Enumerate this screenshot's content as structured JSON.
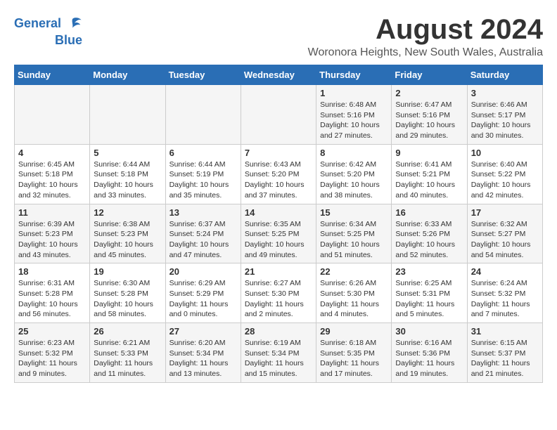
{
  "logo": {
    "line1": "General",
    "line2": "Blue"
  },
  "title": "August 2024",
  "location": "Woronora Heights, New South Wales, Australia",
  "weekdays": [
    "Sunday",
    "Monday",
    "Tuesday",
    "Wednesday",
    "Thursday",
    "Friday",
    "Saturday"
  ],
  "weeks": [
    [
      {
        "day": "",
        "info": ""
      },
      {
        "day": "",
        "info": ""
      },
      {
        "day": "",
        "info": ""
      },
      {
        "day": "",
        "info": ""
      },
      {
        "day": "1",
        "info": "Sunrise: 6:48 AM\nSunset: 5:16 PM\nDaylight: 10 hours\nand 27 minutes."
      },
      {
        "day": "2",
        "info": "Sunrise: 6:47 AM\nSunset: 5:16 PM\nDaylight: 10 hours\nand 29 minutes."
      },
      {
        "day": "3",
        "info": "Sunrise: 6:46 AM\nSunset: 5:17 PM\nDaylight: 10 hours\nand 30 minutes."
      }
    ],
    [
      {
        "day": "4",
        "info": "Sunrise: 6:45 AM\nSunset: 5:18 PM\nDaylight: 10 hours\nand 32 minutes."
      },
      {
        "day": "5",
        "info": "Sunrise: 6:44 AM\nSunset: 5:18 PM\nDaylight: 10 hours\nand 33 minutes."
      },
      {
        "day": "6",
        "info": "Sunrise: 6:44 AM\nSunset: 5:19 PM\nDaylight: 10 hours\nand 35 minutes."
      },
      {
        "day": "7",
        "info": "Sunrise: 6:43 AM\nSunset: 5:20 PM\nDaylight: 10 hours\nand 37 minutes."
      },
      {
        "day": "8",
        "info": "Sunrise: 6:42 AM\nSunset: 5:20 PM\nDaylight: 10 hours\nand 38 minutes."
      },
      {
        "day": "9",
        "info": "Sunrise: 6:41 AM\nSunset: 5:21 PM\nDaylight: 10 hours\nand 40 minutes."
      },
      {
        "day": "10",
        "info": "Sunrise: 6:40 AM\nSunset: 5:22 PM\nDaylight: 10 hours\nand 42 minutes."
      }
    ],
    [
      {
        "day": "11",
        "info": "Sunrise: 6:39 AM\nSunset: 5:23 PM\nDaylight: 10 hours\nand 43 minutes."
      },
      {
        "day": "12",
        "info": "Sunrise: 6:38 AM\nSunset: 5:23 PM\nDaylight: 10 hours\nand 45 minutes."
      },
      {
        "day": "13",
        "info": "Sunrise: 6:37 AM\nSunset: 5:24 PM\nDaylight: 10 hours\nand 47 minutes."
      },
      {
        "day": "14",
        "info": "Sunrise: 6:35 AM\nSunset: 5:25 PM\nDaylight: 10 hours\nand 49 minutes."
      },
      {
        "day": "15",
        "info": "Sunrise: 6:34 AM\nSunset: 5:25 PM\nDaylight: 10 hours\nand 51 minutes."
      },
      {
        "day": "16",
        "info": "Sunrise: 6:33 AM\nSunset: 5:26 PM\nDaylight: 10 hours\nand 52 minutes."
      },
      {
        "day": "17",
        "info": "Sunrise: 6:32 AM\nSunset: 5:27 PM\nDaylight: 10 hours\nand 54 minutes."
      }
    ],
    [
      {
        "day": "18",
        "info": "Sunrise: 6:31 AM\nSunset: 5:28 PM\nDaylight: 10 hours\nand 56 minutes."
      },
      {
        "day": "19",
        "info": "Sunrise: 6:30 AM\nSunset: 5:28 PM\nDaylight: 10 hours\nand 58 minutes."
      },
      {
        "day": "20",
        "info": "Sunrise: 6:29 AM\nSunset: 5:29 PM\nDaylight: 11 hours\nand 0 minutes."
      },
      {
        "day": "21",
        "info": "Sunrise: 6:27 AM\nSunset: 5:30 PM\nDaylight: 11 hours\nand 2 minutes."
      },
      {
        "day": "22",
        "info": "Sunrise: 6:26 AM\nSunset: 5:30 PM\nDaylight: 11 hours\nand 4 minutes."
      },
      {
        "day": "23",
        "info": "Sunrise: 6:25 AM\nSunset: 5:31 PM\nDaylight: 11 hours\nand 5 minutes."
      },
      {
        "day": "24",
        "info": "Sunrise: 6:24 AM\nSunset: 5:32 PM\nDaylight: 11 hours\nand 7 minutes."
      }
    ],
    [
      {
        "day": "25",
        "info": "Sunrise: 6:23 AM\nSunset: 5:32 PM\nDaylight: 11 hours\nand 9 minutes."
      },
      {
        "day": "26",
        "info": "Sunrise: 6:21 AM\nSunset: 5:33 PM\nDaylight: 11 hours\nand 11 minutes."
      },
      {
        "day": "27",
        "info": "Sunrise: 6:20 AM\nSunset: 5:34 PM\nDaylight: 11 hours\nand 13 minutes."
      },
      {
        "day": "28",
        "info": "Sunrise: 6:19 AM\nSunset: 5:34 PM\nDaylight: 11 hours\nand 15 minutes."
      },
      {
        "day": "29",
        "info": "Sunrise: 6:18 AM\nSunset: 5:35 PM\nDaylight: 11 hours\nand 17 minutes."
      },
      {
        "day": "30",
        "info": "Sunrise: 6:16 AM\nSunset: 5:36 PM\nDaylight: 11 hours\nand 19 minutes."
      },
      {
        "day": "31",
        "info": "Sunrise: 6:15 AM\nSunset: 5:37 PM\nDaylight: 11 hours\nand 21 minutes."
      }
    ]
  ]
}
